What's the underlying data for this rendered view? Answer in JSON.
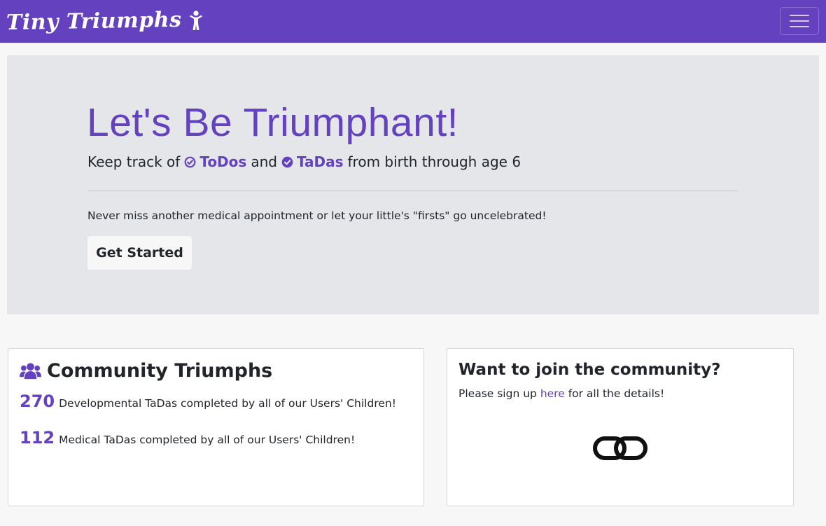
{
  "navbar": {
    "brand_text": "Tiny Triumphs",
    "brand_icon": "child-icon",
    "toggler_icon": "hamburger-menu-icon"
  },
  "hero": {
    "title": "Let's Be Triumphant!",
    "lead_prefix": "Keep track of",
    "todos": "ToDos",
    "and": "and",
    "tadas": "TaDas",
    "lead_suffix": "from birth through age 6",
    "text": "Never miss another medical appointment or let your little's \"firsts\" go uncelebrated!",
    "button": "Get Started"
  },
  "community": {
    "icon": "users-icon",
    "title": "Community Triumphs",
    "stats": [
      {
        "value": "270",
        "label": "Developmental TaDas completed by all of our Users' Children!"
      },
      {
        "value": "112",
        "label": "Medical TaDas completed by all of our Users' Children!"
      }
    ]
  },
  "join": {
    "title": "Want to join the community?",
    "text_before": "Please sign up",
    "link": "here",
    "text_after": "for all the details!",
    "icon": "link-icon"
  },
  "colors": {
    "brand": "#6441bf",
    "hero_bg": "#e4e6ea",
    "page_bg": "#f7f7f7"
  }
}
